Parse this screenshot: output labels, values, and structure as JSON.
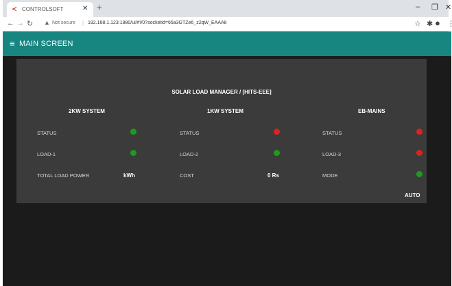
{
  "browser": {
    "tab_title": "CONTROLSOFT",
    "favicon": "controlsoft-icon",
    "not_secure": "Not secure",
    "url": "192.168.1.123:1880/ui/#!/0?socketid=65a3GTZe6_z2qW_EAAA8"
  },
  "app": {
    "title": "MAIN SCREEN",
    "panel_title": "SOLAR LOAD MANAGER / [HITS-EEE]"
  },
  "columns": [
    {
      "heading": "2KW SYSTEM",
      "rows": [
        {
          "label": "STATUS",
          "indicator": "#1a9e1a"
        },
        {
          "label": "LOAD-1",
          "indicator": "#1a9e1a"
        },
        {
          "label": "TOTAL LOAD POWER",
          "value": "kWh"
        }
      ]
    },
    {
      "heading": "1KW SYSTEM",
      "rows": [
        {
          "label": "STATUS",
          "indicator": "#e02020"
        },
        {
          "label": "LOAD-2",
          "indicator": "#1a9e1a"
        },
        {
          "label": "COST",
          "value": "0 Rs"
        }
      ]
    },
    {
      "heading": "EB-MAINS",
      "rows": [
        {
          "label": "STATUS",
          "indicator": "#e02020"
        },
        {
          "label": "LOAD-3",
          "indicator": "#e02020"
        },
        {
          "label": "MODE",
          "indicator": "#1a9e1a"
        }
      ],
      "mode_value": "AUTO"
    }
  ],
  "colors": {
    "appbar": "#188680",
    "background": "#1b1b1b",
    "panel": "#3b3b3b",
    "on": "#1a9e1a",
    "off": "#e02020"
  }
}
